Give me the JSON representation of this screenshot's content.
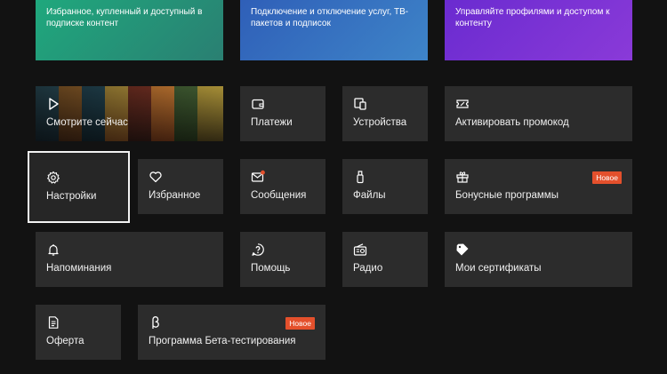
{
  "hero": [
    {
      "desc": "Избранное, купленный и доступный в подписке контент",
      "color_from": "#1fa87d",
      "color_to": "#2a7f72"
    },
    {
      "desc": "Подключение и отключение услуг, ТВ-пакетов и подписок",
      "color_from": "#2f5fb8",
      "color_to": "#3e84c8"
    },
    {
      "desc": "Управляйте профилями и доступом к контенту",
      "color_from": "#6a2bd0",
      "color_to": "#8a3ad8"
    }
  ],
  "tiles": {
    "watch_now": {
      "label": "Смотрите сейчас",
      "icon": "play-icon"
    },
    "payments": {
      "label": "Платежи",
      "icon": "wallet-icon"
    },
    "devices": {
      "label": "Устройства",
      "icon": "devices-icon"
    },
    "promo": {
      "label": "Активировать промокод",
      "icon": "ticket-icon"
    },
    "settings": {
      "label": "Настройки",
      "icon": "gear-icon"
    },
    "favorites": {
      "label": "Избранное",
      "icon": "heart-icon"
    },
    "messages": {
      "label": "Сообщения",
      "icon": "mail-icon"
    },
    "files": {
      "label": "Файлы",
      "icon": "usb-icon"
    },
    "bonus": {
      "label": "Бонусные программы",
      "icon": "gift-icon",
      "badge": "Новое"
    },
    "reminders": {
      "label": "Напоминания",
      "icon": "bell-icon"
    },
    "help": {
      "label": "Помощь",
      "icon": "help-icon"
    },
    "radio": {
      "label": "Радио",
      "icon": "radio-icon"
    },
    "certificates": {
      "label": "Мои сертификаты",
      "icon": "tag-icon"
    },
    "offer": {
      "label": "Оферта",
      "icon": "document-icon"
    },
    "beta": {
      "label": "Программа Бета-тестирования",
      "icon": "beta-icon",
      "badge": "Новое"
    }
  },
  "colors": {
    "background": "#121212",
    "tile": "#2c2c2c",
    "badge": "#e4502c",
    "focus": "#f2f2f2"
  }
}
